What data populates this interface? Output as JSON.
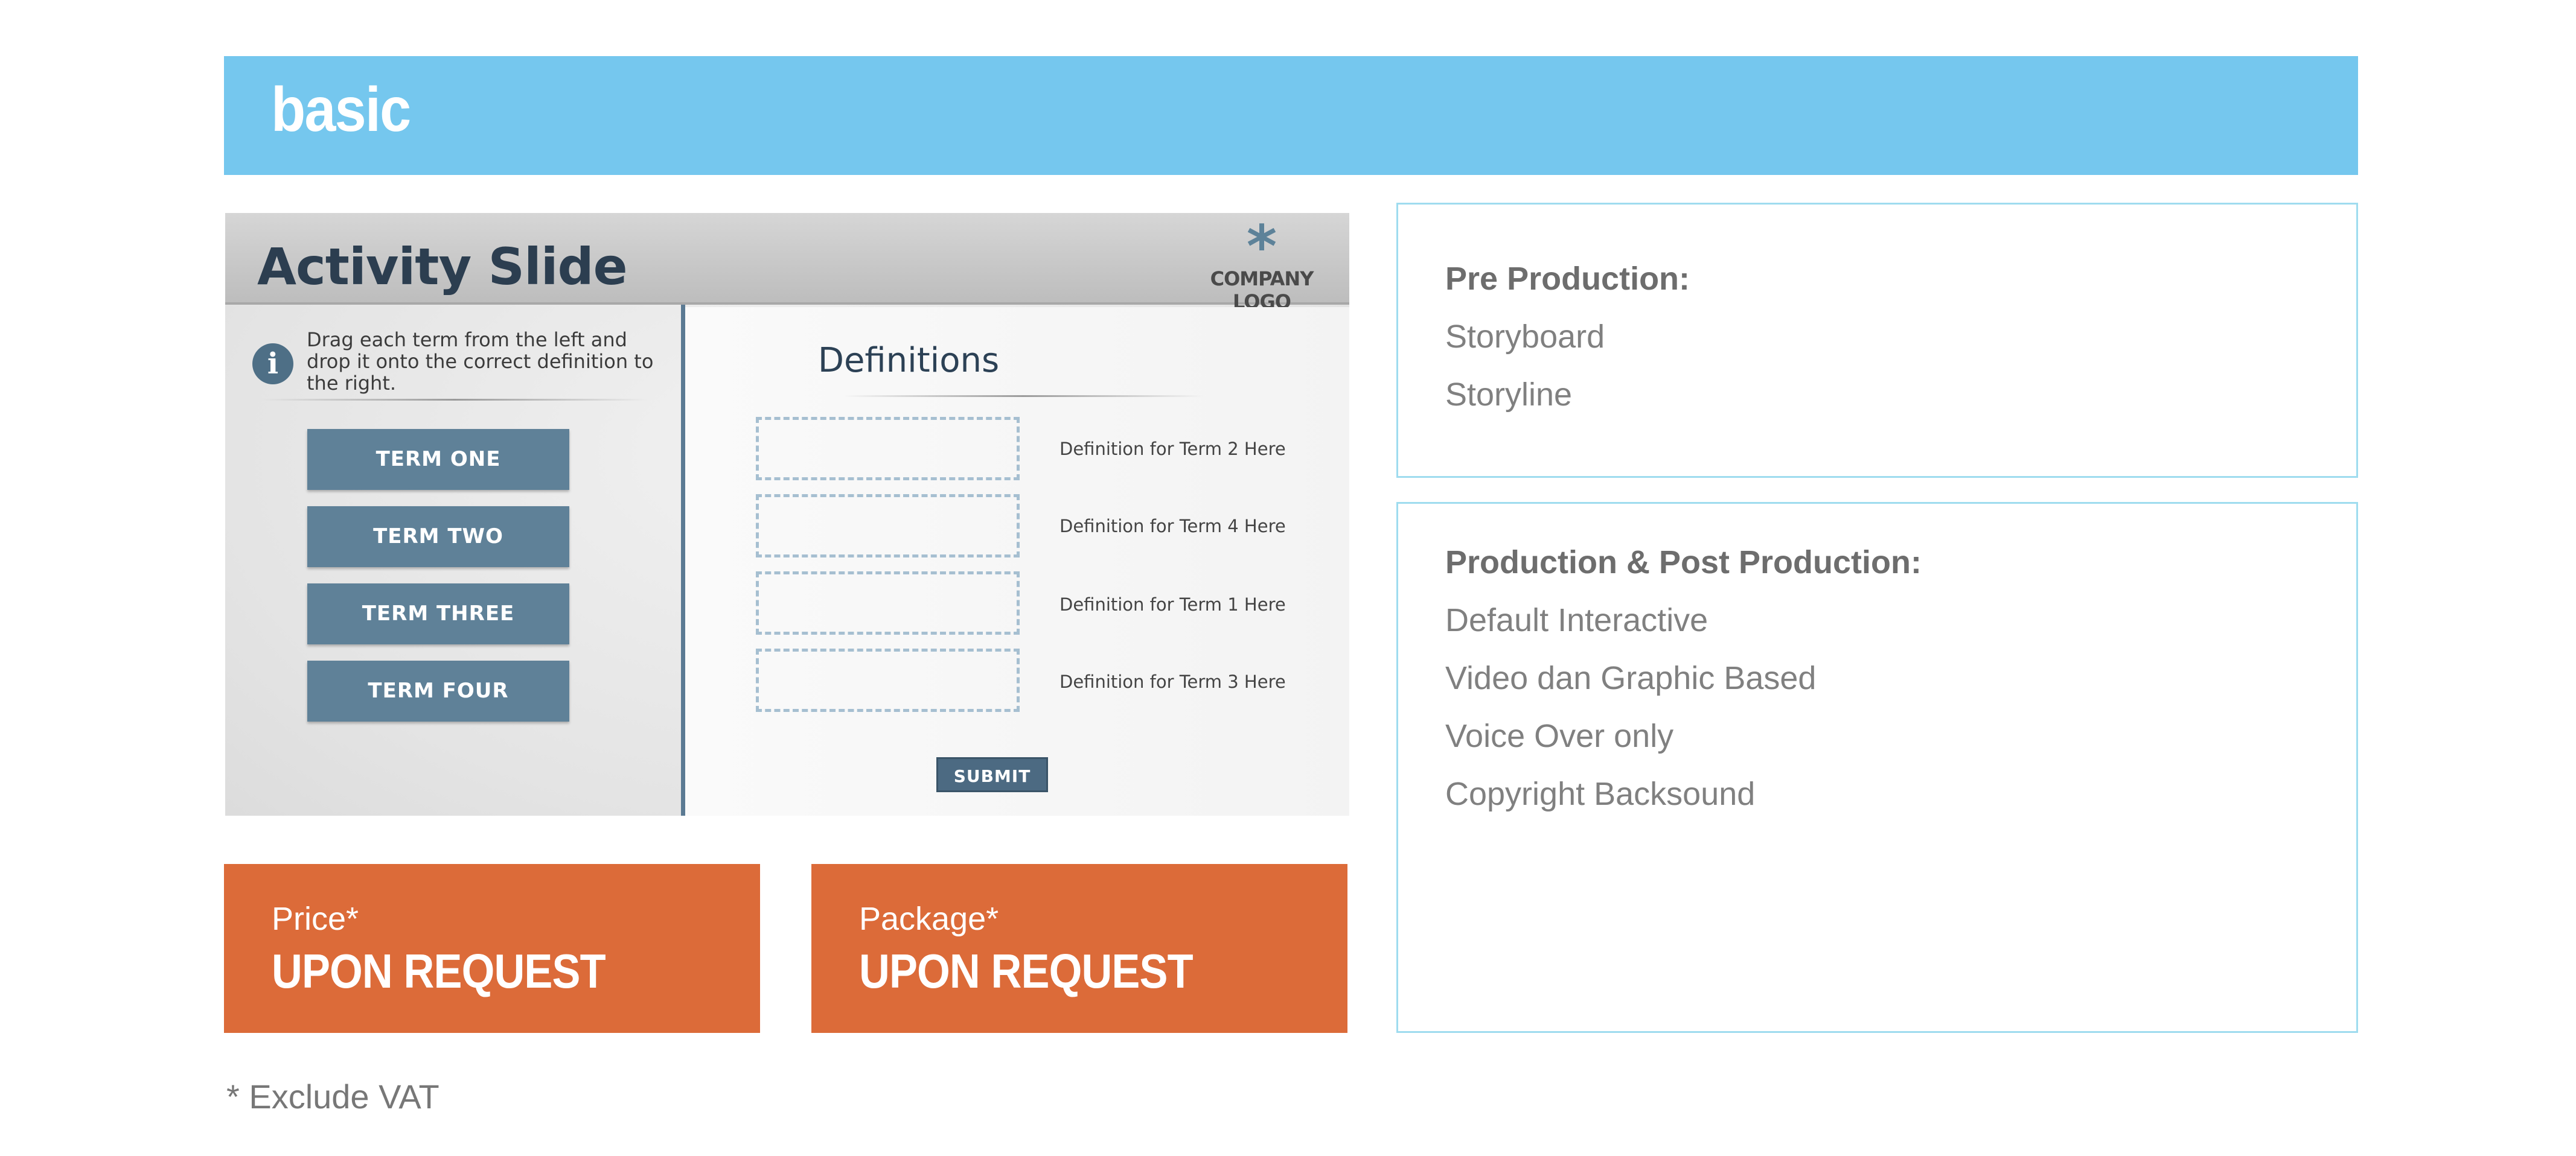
{
  "header": {
    "title": "basic"
  },
  "slide": {
    "title": "Activity Slide",
    "logo_symbol": "*",
    "logo_text": "COMPANY LOGO",
    "info_icon": "i",
    "instruction": "Drag each term from the left and drop it onto the correct definition to the right.",
    "terms": [
      "TERM ONE",
      "TERM TWO",
      "TERM THREE",
      "TERM FOUR"
    ],
    "definitions_title": "Definitions",
    "definitions": [
      "Definition for Term 2 Here",
      "Definition for Term 4 Here",
      "Definition for Term 1 Here",
      "Definition for Term 3 Here"
    ],
    "submit_label": "SUBMIT"
  },
  "pricing": {
    "price": {
      "label": "Price*",
      "value": "UPON REQUEST"
    },
    "package": {
      "label": "Package*",
      "value": "UPON REQUEST"
    },
    "footnote": "* Exclude VAT"
  },
  "pre_production": {
    "heading": "Pre Production:",
    "items": [
      "Storyboard",
      "Storyline"
    ]
  },
  "production": {
    "heading": "Production & Post Production:",
    "items": [
      "Default Interactive",
      "Video dan Graphic Based",
      "Voice Over only",
      "Copyright Backsound"
    ]
  },
  "colors": {
    "header_blue": "#75c7ee",
    "price_orange": "#dc6b39",
    "term_blue": "#5f8198",
    "panel_border": "#9fdcef"
  }
}
